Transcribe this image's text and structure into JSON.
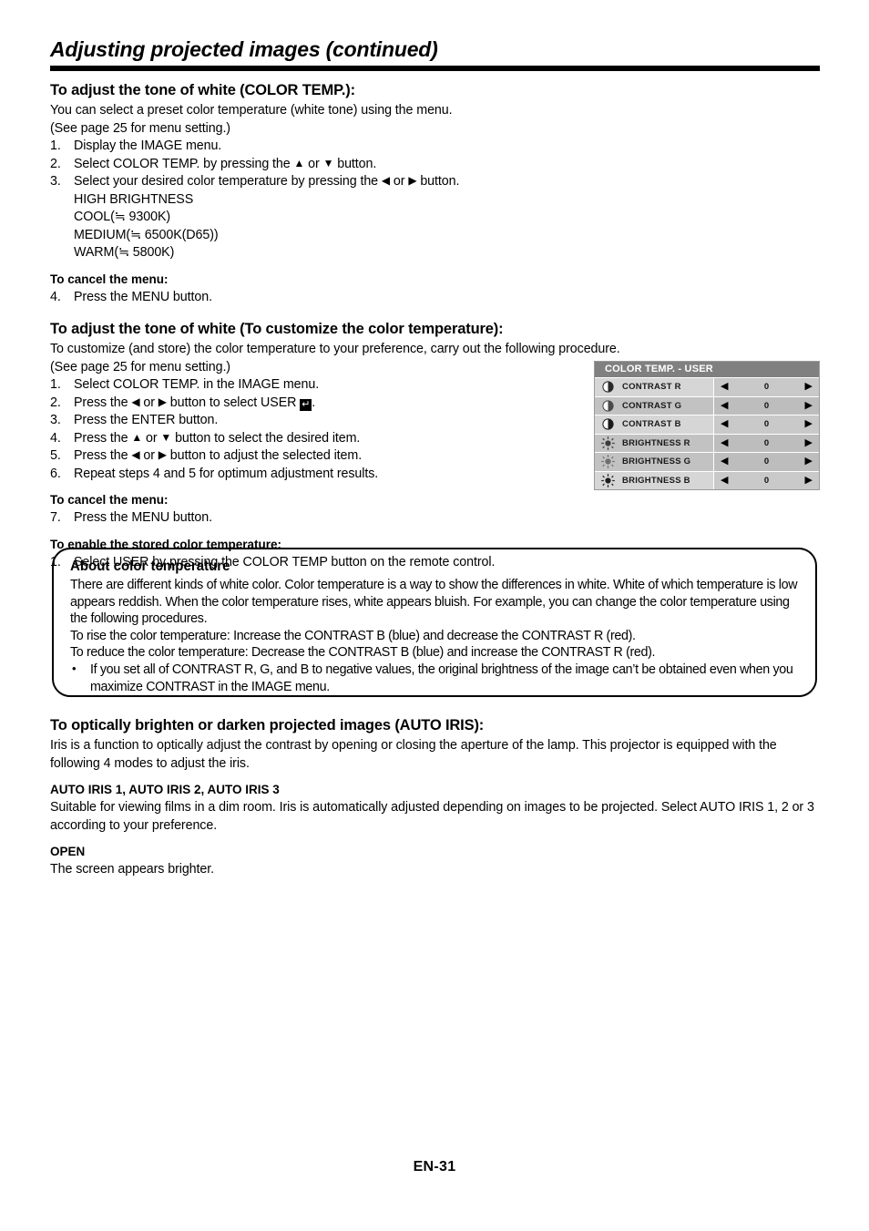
{
  "header": {
    "title": "Adjusting projected images (continued)"
  },
  "section1": {
    "heading": "To adjust the tone of white (COLOR TEMP.):",
    "intro1": "You can select a preset color temperature (white tone) using the menu.",
    "intro2": "(See page 25 for menu setting.)",
    "steps": [
      {
        "num": "1.",
        "text": "Display the IMAGE menu."
      },
      {
        "num": "2.",
        "text_before": "Select COLOR TEMP. by pressing the ",
        "tri1": "▲",
        "mid": " or ",
        "tri2": "▼",
        "text_after": " button."
      },
      {
        "num": "3.",
        "text_before": "Select your desired color temperature by pressing the ",
        "tri1": "◀",
        "mid": " or ",
        "tri2": "▶",
        "text_after": " button."
      }
    ],
    "presets": [
      "HIGH BRIGHTNESS",
      "COOL(≒ 9300K)",
      "MEDIUM(≒ 6500K(D65))",
      "WARM(≒ 5800K)"
    ],
    "cancel_heading": "To cancel the menu:",
    "cancel_step": {
      "num": "4.",
      "text": "Press the MENU button."
    }
  },
  "section2": {
    "heading": "To adjust the tone of white (To customize the color temperature):",
    "intro1": "To customize (and store) the color temperature to your preference, carry out the following procedure.",
    "intro2": "(See page 25 for menu setting.)",
    "steps": [
      {
        "num": "1.",
        "text": "Select COLOR TEMP. in the IMAGE menu."
      },
      {
        "num": "2.",
        "text_before": "Press the ",
        "tri1": "◀",
        "mid": " or ",
        "tri2": "▶",
        "text_after": " button to select USER ",
        "key": "↵",
        "tail": "."
      },
      {
        "num": "3.",
        "text": "Press the ENTER button."
      },
      {
        "num": "4.",
        "text_before": "Press the ",
        "tri1": "▲",
        "mid": " or ",
        "tri2": "▼",
        "text_after": " button to select the desired item."
      },
      {
        "num": "5.",
        "text_before": "Press the ",
        "tri1": "◀",
        "mid": " or ",
        "tri2": "▶",
        "text_after": " button to adjust the selected item."
      },
      {
        "num": "6.",
        "text": "Repeat steps 4 and 5 for optimum adjustment results."
      }
    ],
    "cancel_heading": "To cancel the menu:",
    "cancel_step": {
      "num": "7.",
      "text": "Press the MENU button."
    },
    "enable_heading": "To enable the stored color temperature:",
    "enable_step": {
      "num": "1.",
      "text": "Select USER by pressing the COLOR TEMP button on the remote control."
    }
  },
  "osd_menu": {
    "title": "COLOR TEMP. - USER",
    "title_bg": "#808080",
    "left_arrow": "◀",
    "right_arrow": "▶",
    "rows": [
      {
        "icon": "contrast-icon",
        "label": "CONTRAST R",
        "value": "0"
      },
      {
        "icon": "contrast-icon",
        "label": "CONTRAST G",
        "value": "0"
      },
      {
        "icon": "contrast-icon",
        "label": "CONTRAST B",
        "value": "0"
      },
      {
        "icon": "brightness-icon",
        "label": "BRIGHTNESS R",
        "value": "0"
      },
      {
        "icon": "brightness-icon",
        "label": "BRIGHTNESS G",
        "value": "0"
      },
      {
        "icon": "brightness-icon",
        "label": "BRIGHTNESS B",
        "value": "0"
      }
    ]
  },
  "about_box": {
    "title": "About color temperature",
    "para1": "There are different kinds of white color. Color temperature is a way to show the differences in white. White of which temperature is low appears reddish. When the color temperature rises, white appears bluish. For example, you can change the color temperature using the following procedures.",
    "para2": "To rise the color temperature: Increase the CONTRAST B (blue) and decrease the CONTRAST R (red).",
    "para3": "To reduce the color temperature: Decrease the CONTRAST B (blue) and increase the CONTRAST R (red).",
    "bullet_dot": "•",
    "bullet1": "If you set all of CONTRAST R, G, and B to negative values, the original brightness of the image can’t be obtained even when you maximize CONTRAST in the IMAGE menu."
  },
  "section3": {
    "heading": "To optically brighten or darken projected images (AUTO IRIS):",
    "para1": "Iris is a function to optically adjust the contrast by opening or closing the aperture of the lamp. This projector is equipped with the following 4 modes to adjust the iris.",
    "sub1_heading": "AUTO IRIS 1, AUTO IRIS 2, AUTO IRIS 3",
    "sub1_para": "Suitable for viewing films in a dim room. Iris is automatically adjusted depending on images to be projected. Select AUTO IRIS 1, 2 or 3 according to your preference.",
    "sub2_heading": "OPEN",
    "sub2_para": "The screen appears brighter."
  },
  "footer": {
    "page_number": "EN-31"
  }
}
